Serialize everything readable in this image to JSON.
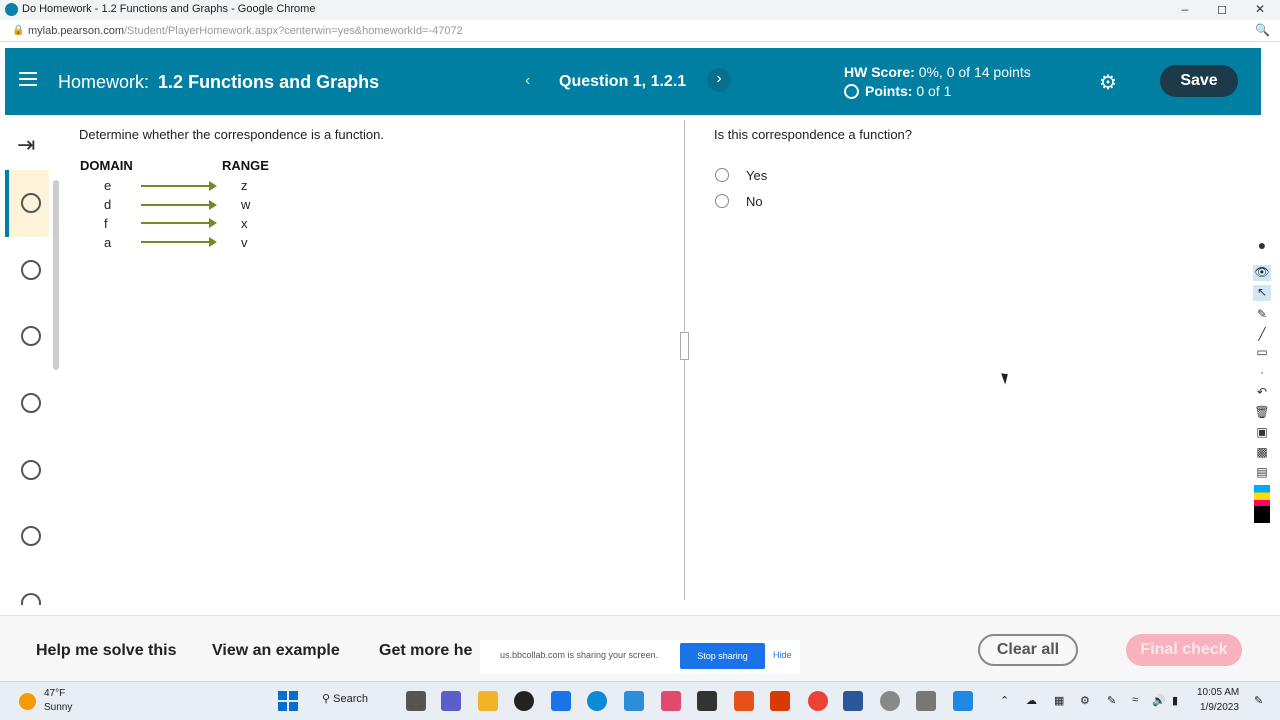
{
  "browser": {
    "window_title": "Do Homework - 1.2 Functions and Graphs - Google Chrome",
    "url_host": "mylab.pearson.com",
    "url_path": "/Student/PlayerHomework.aspx?centerwin=yes&homeworkId=-47072"
  },
  "header": {
    "homework_label": "Homework:",
    "homework_name": "1.2 Functions and Graphs",
    "question_label": "Question 1, 1.2.1",
    "hw_score_label": "HW Score:",
    "hw_score_value": "0%, 0 of 14 points",
    "points_label": "Points:",
    "points_value": "0 of 1",
    "save_label": "Save",
    "accent_color": "#007fa3"
  },
  "left_panel": {
    "prompt": "Determine whether the correspondence is a function.",
    "domain_header": "DOMAIN",
    "range_header": "RANGE",
    "mapping": [
      {
        "domain": "e",
        "range": "z"
      },
      {
        "domain": "d",
        "range": "w"
      },
      {
        "domain": "f",
        "range": "x"
      },
      {
        "domain": "a",
        "range": "v"
      }
    ]
  },
  "right_panel": {
    "question": "Is this correspondence a function?",
    "options": [
      "Yes",
      "No"
    ]
  },
  "footer": {
    "help_label": "Help me solve this",
    "example_label": "View an example",
    "more_help_label": "Get more he",
    "share_message": "us.bbcollab.com is sharing your screen.",
    "stop_sharing_label": "Stop sharing",
    "hide_label": "Hide",
    "clear_all_label": "Clear all",
    "final_check_label": "Final check"
  },
  "taskbar": {
    "temperature": "47°F",
    "weather": "Sunny",
    "search_label": "Search",
    "time": "10:05 AM",
    "date": "1/9/2023"
  }
}
